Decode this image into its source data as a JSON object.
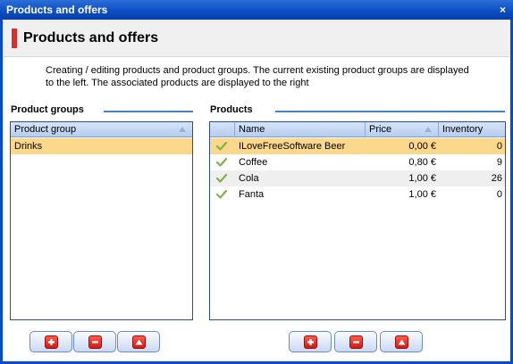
{
  "window": {
    "title": "Products and offers",
    "close_glyph": "×"
  },
  "header": {
    "title": "Products and offers"
  },
  "description": "Creating / editing products and product groups. The current existing product groups are displayed to the left. The associated products are displayed to the right",
  "product_groups": {
    "section_title": "Product groups",
    "column": "Product group",
    "rows": [
      "Drinks"
    ],
    "selected_index": 0
  },
  "products": {
    "section_title": "Products",
    "columns": {
      "name": "Name",
      "price": "Price",
      "inventory": "Inventory"
    },
    "rows": [
      {
        "name": "ILoveFreeSoftware Beer",
        "price": "0,00 €",
        "inventory": "0",
        "status_icon": "check-icon"
      },
      {
        "name": "Coffee",
        "price": "0,80 €",
        "inventory": "9",
        "status_icon": "check-icon"
      },
      {
        "name": "Cola",
        "price": "1,00 €",
        "inventory": "26",
        "status_icon": "check-icon"
      },
      {
        "name": "Fanta",
        "price": "1,00 €",
        "inventory": "0",
        "status_icon": "check-icon"
      }
    ],
    "selected_index": 0
  },
  "buttons": {
    "add_icon": "plus-icon",
    "remove_icon": "minus-icon",
    "edit_icon": "triangle-up-icon"
  },
  "colors": {
    "title_bar": "#0a4cc4",
    "accent": "#d8302c",
    "selection": "#fbd88c",
    "grid_border": "#2f4f8a"
  }
}
